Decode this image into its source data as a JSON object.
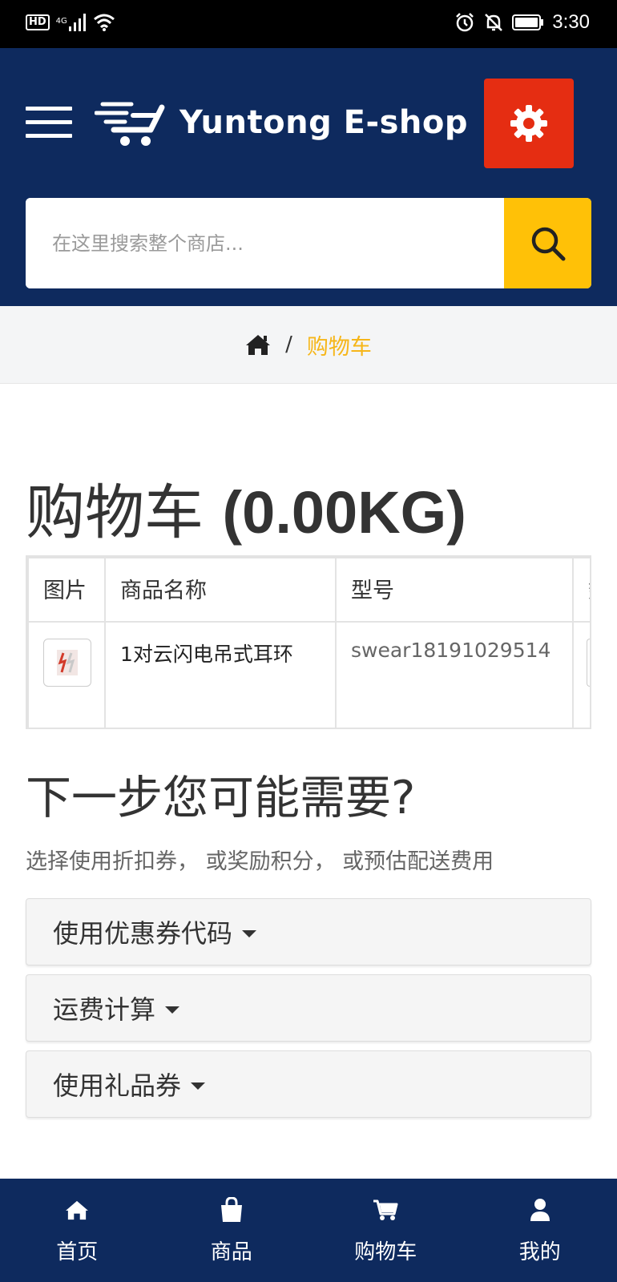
{
  "status_bar": {
    "left_badge": "HD",
    "signal_label": "4G",
    "time": "3:30"
  },
  "header": {
    "brand": "Yuntong E-shop",
    "colors": {
      "background": "#0e2a5e",
      "settings": "#e52d12",
      "search_button": "#ffc107"
    },
    "icons": {
      "menu": "hamburger-icon",
      "logo": "cart-logo-icon",
      "settings": "gear-icon",
      "search": "search-icon"
    }
  },
  "search": {
    "placeholder": "在这里搜索整个商店...",
    "value": ""
  },
  "breadcrumb": {
    "home_icon": "home-icon",
    "separator": "/",
    "current": "购物车",
    "current_color": "#f6b619"
  },
  "cart": {
    "title": "购物车",
    "weight": "(0.00KG)",
    "columns": [
      "图片",
      "商品名称",
      "型号",
      "数"
    ],
    "rows": [
      {
        "image_icon": "product-thumbnail",
        "name": "1对云闪电吊式耳环",
        "model": "swear18191029514"
      }
    ]
  },
  "next_steps": {
    "title": "下一步您可能需要?",
    "description": "选择使用折扣券，  或奖励积分，  或预估配送费用",
    "sections": [
      {
        "label": "使用优惠券代码",
        "icon": "caret-down-icon"
      },
      {
        "label": "运费计算",
        "icon": "caret-down-icon"
      },
      {
        "label": "使用礼品券",
        "icon": "caret-down-icon"
      }
    ]
  },
  "bottom_nav": {
    "items": [
      {
        "label": "首页",
        "icon": "home-icon"
      },
      {
        "label": "商品",
        "icon": "shopping-bag-icon"
      },
      {
        "label": "购物车",
        "icon": "cart-icon"
      },
      {
        "label": "我的",
        "icon": "user-icon"
      }
    ]
  }
}
